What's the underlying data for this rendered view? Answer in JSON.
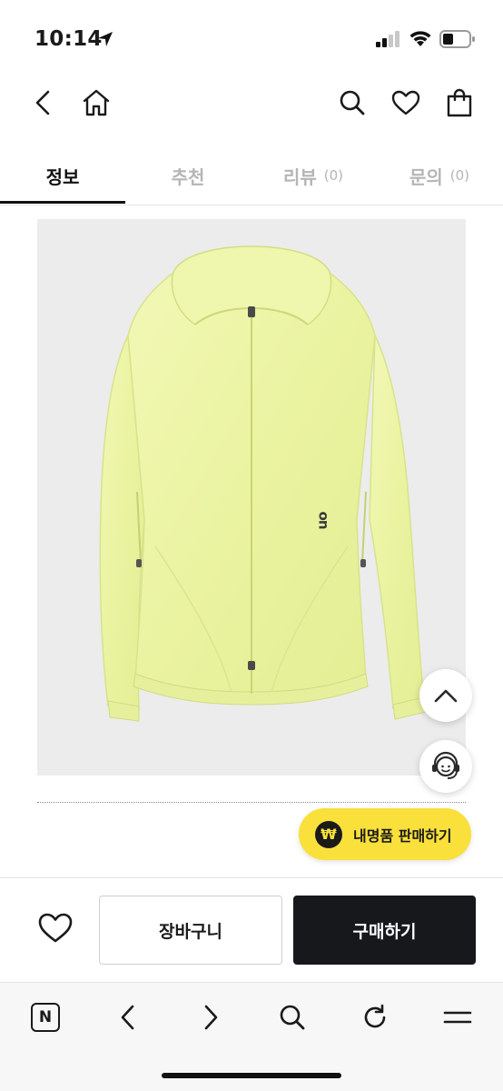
{
  "status_bar": {
    "time": "10:14",
    "icons": [
      "location-arrow-icon",
      "signal-icon",
      "wifi-icon",
      "battery-icon"
    ]
  },
  "top_nav": {
    "icons": [
      "back-icon",
      "home-icon",
      "search-icon",
      "heart-icon",
      "shopping-bag-icon"
    ]
  },
  "tabs": [
    {
      "label": "정보",
      "count": "",
      "active": true
    },
    {
      "label": "추천",
      "count": "",
      "active": false
    },
    {
      "label": "리뷰",
      "count": "(0)",
      "active": false
    },
    {
      "label": "문의",
      "count": "(0)",
      "active": false
    }
  ],
  "product": {
    "image": "light-yellow-hooded-windbreaker-jacket",
    "logo_text": "on"
  },
  "floating": {
    "scroll_top_icon": "chevron-up-icon",
    "support_icon": "headset-agent-icon",
    "sell_button": {
      "icon_text": "₩",
      "label": "내명품 판매하기"
    }
  },
  "purchase_bar": {
    "wish_icon": "heart-outline-icon",
    "cart_label": "장바구니",
    "buy_label": "구매하기"
  },
  "browser_toolbar": {
    "icons": [
      "naver-n-icon",
      "back-arrow-icon",
      "forward-arrow-icon",
      "search-icon",
      "refresh-icon",
      "menu-icon"
    ],
    "naver_letter": "N"
  },
  "colors": {
    "accent_yellow": "#f9e03a",
    "buy_button": "#16181c",
    "jacket": "#eef5a8",
    "image_bg": "#ececec"
  }
}
